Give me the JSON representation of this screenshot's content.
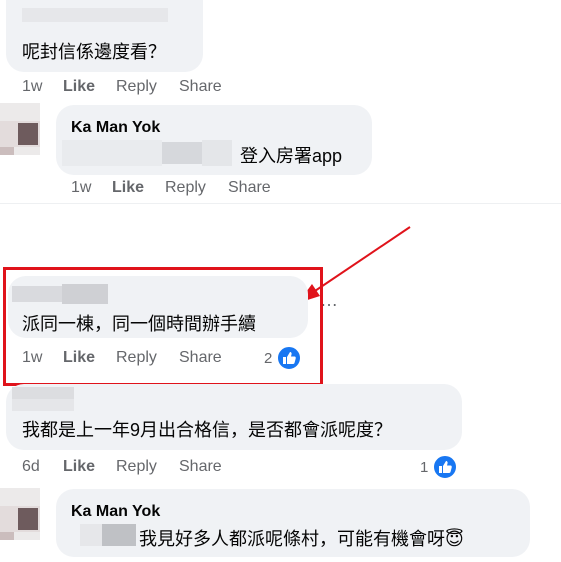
{
  "comments": [
    {
      "text": "呢封信係邊度看？",
      "time": "1w",
      "like": "Like",
      "reply": "Reply",
      "share": "Share"
    },
    {
      "author": "Ka Man Yok",
      "text": "登入房署app",
      "time": "1w",
      "like": "Like",
      "reply": "Reply",
      "share": "Share"
    },
    {
      "text": "派同一棟，同一個時間辦手續",
      "time": "1w",
      "like": "Like",
      "reply": "Reply",
      "share": "Share",
      "reactions": "2",
      "more": "…"
    },
    {
      "text": "我都是上一年9月出合格信，是否都會派呢度？",
      "time": "6d",
      "like": "Like",
      "reply": "Reply",
      "share": "Share",
      "reactions": "1"
    },
    {
      "author": "Ka Man Yok",
      "text": "我見好多人都派呢條村，可能有機會呀",
      "emoji": "😇"
    }
  ],
  "icons": {
    "reaction": "like-thumb-icon",
    "annotation": "red-arrow-icon",
    "highlight": "red-highlight-box"
  },
  "colors": {
    "highlight": "#e0131b",
    "like_blue": "#1877f2",
    "bubble": "#f0f2f5",
    "meta": "#65676b"
  }
}
